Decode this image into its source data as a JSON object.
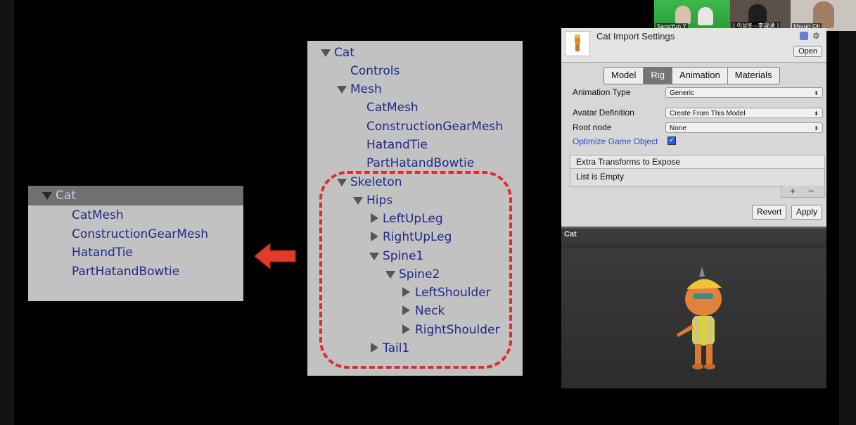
{
  "participants": [
    {
      "name": "SangYun Y"
    },
    {
      "name": "( 이성훈 - 李晟湧 )"
    },
    {
      "name": "Jihyun Oh"
    }
  ],
  "small_tree": {
    "root": "Cat",
    "children": [
      "CatMesh",
      "ConstructionGearMesh",
      "HatandTie",
      "PartHatandBowtie"
    ]
  },
  "big_tree": {
    "root": "Cat",
    "controls": "Controls",
    "mesh": "Mesh",
    "mesh_children": [
      "CatMesh",
      "ConstructionGearMesh",
      "HatandTie",
      "PartHatandBowtie"
    ],
    "skeleton": "Skeleton",
    "hips": "Hips",
    "left_up_leg": "LeftUpLeg",
    "right_up_leg": "RightUpLeg",
    "spine1": "Spine1",
    "spine2": "Spine2",
    "left_shoulder": "LeftShoulder",
    "neck": "Neck",
    "right_shoulder": "RightShoulder",
    "tail1": "Tail1"
  },
  "inspector": {
    "title": "Cat Import Settings",
    "open_label": "Open",
    "tabs": [
      {
        "label": "Model",
        "active": false
      },
      {
        "label": "Rig",
        "active": true
      },
      {
        "label": "Animation",
        "active": false
      },
      {
        "label": "Materials",
        "active": false
      }
    ],
    "animation_type_label": "Animation Type",
    "animation_type_value": "Generic",
    "avatar_definition_label": "Avatar Definition",
    "avatar_definition_value": "Create From This Model",
    "root_node_label": "Root node",
    "root_node_value": "None",
    "optimize_label": "Optimize Game Object",
    "optimize_checked": true,
    "extra_transforms_label": "Extra Transforms to Expose",
    "list_empty_label": "List is Empty",
    "plus": "+",
    "minus": "−",
    "revert_label": "Revert",
    "apply_label": "Apply",
    "preview_title": "Cat"
  },
  "colors": {
    "highlight_dash": "#e02d2d",
    "arrow": "#e23b2a",
    "tree_text": "#1f2a8a",
    "tree_bg": "#c2c2c2"
  }
}
